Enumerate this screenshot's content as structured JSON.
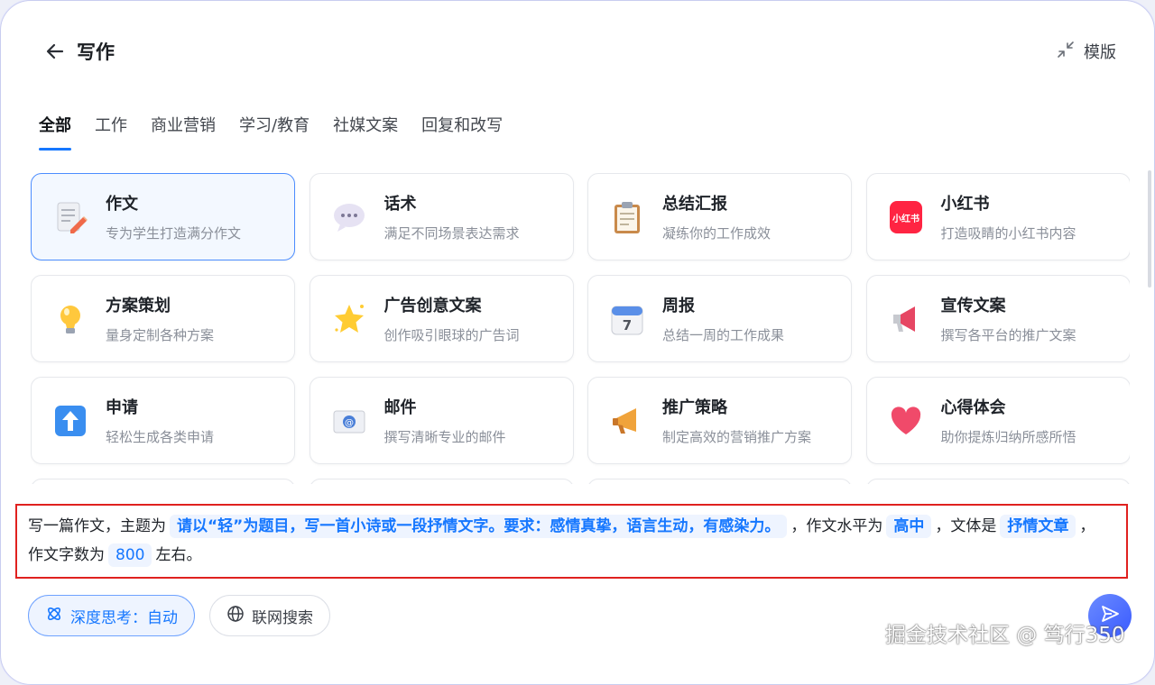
{
  "header": {
    "title": "写作",
    "template_label": "模版"
  },
  "tabs": [
    "全部",
    "工作",
    "商业营销",
    "学习/教育",
    "社媒文案",
    "回复和改写"
  ],
  "cards": [
    {
      "title": "作文",
      "desc": "专为学生打造满分作文",
      "icon": "essay-pencil-icon"
    },
    {
      "title": "话术",
      "desc": "满足不同场景表达需求",
      "icon": "speech-bubble-icon"
    },
    {
      "title": "总结汇报",
      "desc": "凝练你的工作成效",
      "icon": "clipboard-icon"
    },
    {
      "title": "小红书",
      "desc": "打造吸睛的小红书内容",
      "icon": "xiaohongshu-logo-icon",
      "logo_text": "小红书"
    },
    {
      "title": "方案策划",
      "desc": "量身定制各种方案",
      "icon": "lightbulb-icon"
    },
    {
      "title": "广告创意文案",
      "desc": "创作吸引眼球的广告词",
      "icon": "star-sparkle-icon"
    },
    {
      "title": "周报",
      "desc": "总结一周的工作成果",
      "icon": "calendar-icon",
      "calendar_day": "7"
    },
    {
      "title": "宣传文案",
      "desc": "撰写各平台的推广文案",
      "icon": "megaphone-icon"
    },
    {
      "title": "申请",
      "desc": "轻松生成各类申请",
      "icon": "up-arrow-icon"
    },
    {
      "title": "邮件",
      "desc": "撰写清晰专业的邮件",
      "icon": "email-icon"
    },
    {
      "title": "推广策略",
      "desc": "制定高效的营销推广方案",
      "icon": "loudspeaker-icon"
    },
    {
      "title": "心得体会",
      "desc": "助你提炼归纳所感所悟",
      "icon": "heart-icon"
    }
  ],
  "prompt": {
    "t1": "写一篇作文，主题为",
    "topic": "请以“轻”为题目，写一首小诗或一段抒情文字。要求：感情真挚，语言生动，有感染力。",
    "t2": "，作文水平为",
    "level": "高中",
    "t3": "，文体是",
    "style": "抒情文章",
    "t4": "，",
    "t5": "作文字数为",
    "count": "800",
    "t6": "左右。"
  },
  "bottom": {
    "deep_think": "深度思考：自动",
    "web_search": "联网搜索"
  },
  "watermark": "掘金技术社区 @ 笃行350",
  "colors": {
    "accent": "#1677ff",
    "highlight_border": "#e0211f"
  }
}
